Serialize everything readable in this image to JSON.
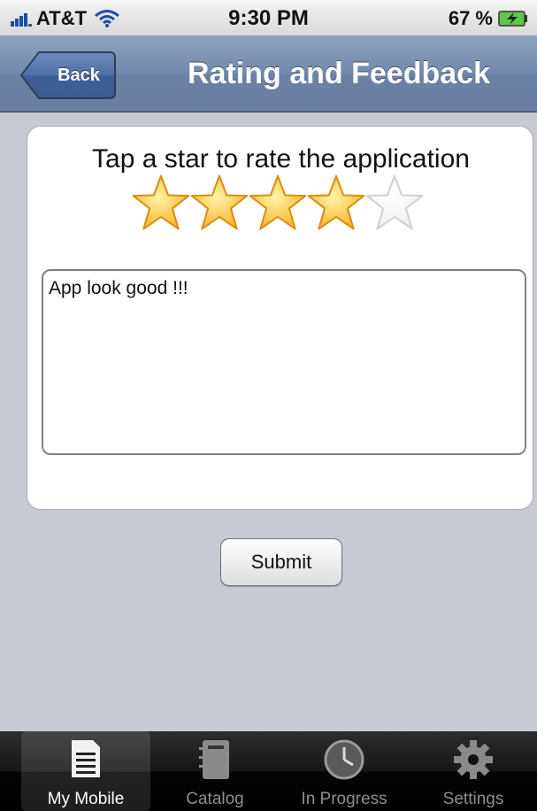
{
  "status_bar": {
    "carrier": "AT&T",
    "time": "9:30 PM",
    "battery_percent": "67 %"
  },
  "nav": {
    "back_label": "Back",
    "title": "Rating and Feedback"
  },
  "rating": {
    "instruction": "Tap a star to rate the application",
    "value": 4,
    "max": 5
  },
  "feedback": {
    "value": "App look good !!!"
  },
  "submit_label": "Submit",
  "tabs": [
    {
      "label": "My Mobile",
      "icon": "document-list-icon",
      "selected": true
    },
    {
      "label": "Catalog",
      "icon": "notebook-icon",
      "selected": false
    },
    {
      "label": "In Progress",
      "icon": "clock-icon",
      "selected": false
    },
    {
      "label": "Settings",
      "icon": "gear-icon",
      "selected": false
    }
  ],
  "colors": {
    "nav_blue": "#6d84a7",
    "star_gold": "#f7b733",
    "background": "#c6cbd3"
  }
}
